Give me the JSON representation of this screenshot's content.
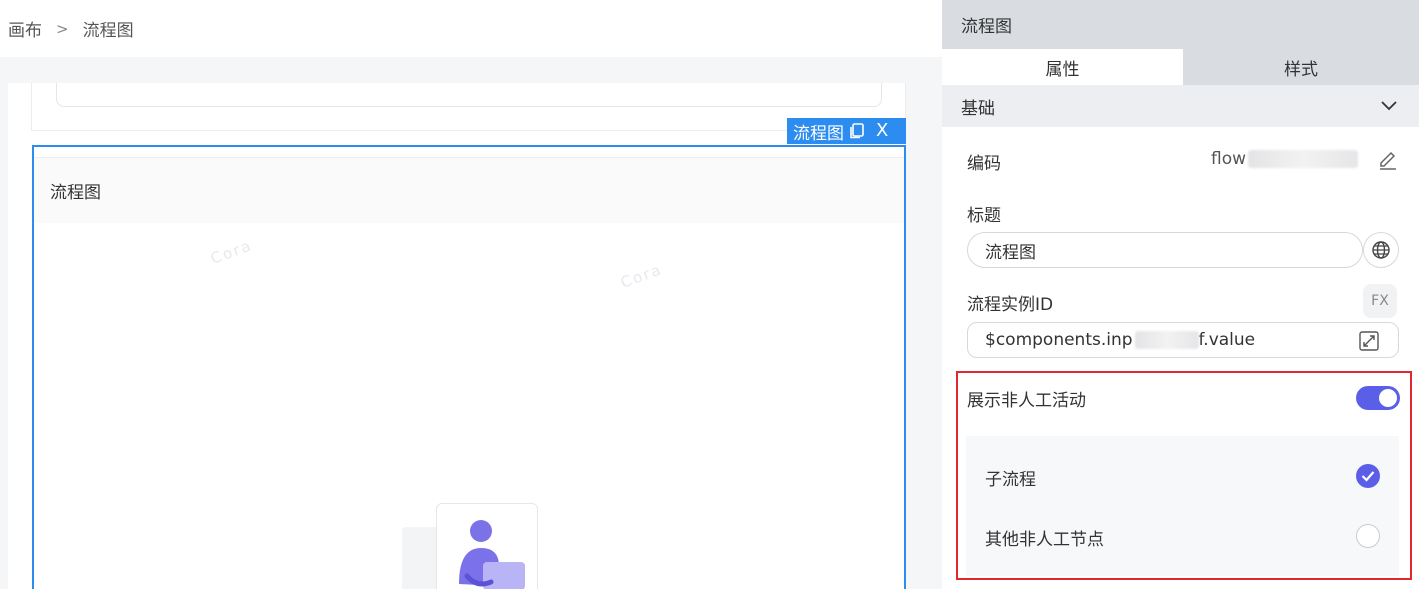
{
  "breadcrumb": {
    "root": "画布",
    "separator": ">",
    "current": "流程图"
  },
  "canvas": {
    "selected_tag": {
      "label": "流程图",
      "close": "X"
    },
    "flow_header": "流程图",
    "watermark": "Cora"
  },
  "panel": {
    "title": "流程图",
    "tabs": [
      {
        "label": "属性",
        "active": true
      },
      {
        "label": "样式",
        "active": false
      }
    ],
    "section": {
      "title": "基础"
    },
    "code": {
      "label": "编码",
      "value_prefix": "flow"
    },
    "title_field": {
      "label": "标题",
      "value": "流程图"
    },
    "instance_id": {
      "label": "流程实例ID",
      "fx": "FX",
      "value_prefix": "$components.inp",
      "value_suffix": "f.value"
    },
    "show_non_manual": {
      "label": "展示非人工活动",
      "enabled": true
    },
    "options": [
      {
        "label": "子流程",
        "checked": true
      },
      {
        "label": "其他非人工节点",
        "checked": false
      }
    ]
  },
  "colors": {
    "accent": "#5b5fe8",
    "selection": "#2d8cf0",
    "highlight_border": "#e0282e"
  }
}
